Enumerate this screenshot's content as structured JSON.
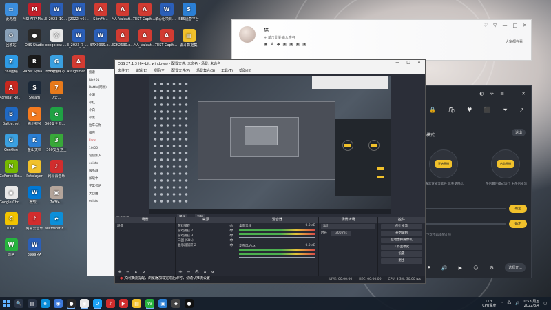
{
  "desktop": {
    "icons": [
      {
        "label": "此电脑",
        "color": "#3b8ede",
        "glyph": "▭"
      },
      {
        "label": "MSI APP Manager",
        "color": "#c41f2a",
        "glyph": "M"
      },
      {
        "label": "E_2023_10_3...",
        "color": "#2b5fb8",
        "glyph": "W"
      },
      {
        "label": "[2022_v6f...",
        "color": "#2b5fb8",
        "glyph": "W"
      },
      {
        "label": "SlimFit...",
        "color": "#d23b32",
        "glyph": "A"
      },
      {
        "label": "MA_Valuati...",
        "color": "#d23b32",
        "glyph": "A"
      },
      {
        "label": "TEST Capital Budgeting...",
        "color": "#d23b32",
        "glyph": "A"
      },
      {
        "label": "单心组项目计划",
        "color": "#2b5fb8",
        "glyph": "W"
      },
      {
        "label": "SES运营平台",
        "color": "#2b7fd4",
        "glyph": "S"
      },
      {
        "label": "回收站",
        "color": "#8aa1b8",
        "glyph": "♻"
      },
      {
        "label": "OBS Studio",
        "color": "#2a2a2a",
        "glyph": "●"
      },
      {
        "label": "bongo cat W 0.3.7",
        "color": "#e8e8e8",
        "glyph": "🐱"
      },
      {
        "label": "E_2023_7_2_H...",
        "color": "#2b5fb8",
        "glyph": "W"
      },
      {
        "label": "BRX3999.x...",
        "color": "#2b5fb8",
        "glyph": "W"
      },
      {
        "label": "ECK2630.x...",
        "color": "#d23b32",
        "glyph": "A"
      },
      {
        "label": "MA_Valuati...",
        "color": "#d23b32",
        "glyph": "A"
      },
      {
        "label": "TEST Capital Budgeting...",
        "color": "#d23b32",
        "glyph": "A"
      },
      {
        "label": "漏斗数据集",
        "color": "#f1c12b",
        "glyph": "▤"
      },
      {
        "label": "individual reflection",
        "color": "#2b5fb8",
        "glyph": "W"
      },
      {
        "label": "Assignment Cover Sheet",
        "color": "#d23b32",
        "glyph": "A"
      },
      {
        "label": "360压缩",
        "color": "#2e9be6",
        "glyph": "Z"
      },
      {
        "label": "Razer Synapse",
        "color": "#1a1a1a",
        "glyph": "R"
      },
      {
        "label": "米哈游 (2)",
        "color": "#3aa0e0",
        "glyph": "G"
      },
      {
        "label": "Acrobat Reader DC",
        "color": "#c8281f",
        "glyph": "A"
      },
      {
        "label": "Steam",
        "color": "#1b2838",
        "glyph": "S"
      },
      {
        "label": "7天...",
        "color": "#e87a1b",
        "glyph": "7"
      },
      {
        "label": "Battle.net",
        "color": "#2069c3",
        "glyph": "B"
      },
      {
        "label": "腾讯视频",
        "color": "#f47b20",
        "glyph": "▶"
      },
      {
        "label": "360安全浏览器",
        "color": "#1fa244",
        "glyph": "e"
      },
      {
        "label": "GeeGee",
        "color": "#3aa0e0",
        "glyph": "G"
      },
      {
        "label": "金山文档",
        "color": "#2b7fd4",
        "glyph": "K"
      },
      {
        "label": "360安全卫士",
        "color": "#38a839",
        "glyph": "3"
      },
      {
        "label": "GeForce Experience",
        "color": "#76b900",
        "glyph": "N"
      },
      {
        "label": "Potplayer",
        "color": "#f1c12b",
        "glyph": "▶"
      },
      {
        "label": "网易云音乐",
        "color": "#d12d2d",
        "glyph": "♪"
      },
      {
        "label": "Google Chrome",
        "color": "#e8e8e8",
        "glyph": "◉"
      },
      {
        "label": "微软...",
        "color": "#0078d4",
        "glyph": "W"
      },
      {
        "label": "7a3f4...",
        "color": "#b4a59b",
        "glyph": "▣"
      },
      {
        "label": "iCUE",
        "color": "#f2c400",
        "glyph": "C"
      },
      {
        "label": "网易云音乐",
        "color": "#d12d2d",
        "glyph": "♪"
      },
      {
        "label": "Microsoft Edge",
        "color": "#0c8fd9",
        "glyph": "e"
      },
      {
        "label": "微信",
        "color": "#27b43e",
        "glyph": "W"
      },
      {
        "label": "3999MA",
        "color": "#2b5fb8",
        "glyph": "W"
      }
    ]
  },
  "qq_window": {
    "name": "猫王",
    "signature": "+ 单击此处输入签名",
    "badges": "▣ ♛ ◆ ▣ ▣ ▣ ▣",
    "right_text": "大家都在看",
    "controls": [
      "♡",
      "▽",
      "—",
      "□",
      "✕"
    ]
  },
  "live_window": {
    "top_icons": [
      "◐",
      "✈",
      "≡",
      "—",
      "✕"
    ],
    "toolbar_icons": [
      "🔒",
      "🛍",
      "♥",
      "⬛",
      "⏷",
      "↗"
    ],
    "mode_label": "模式",
    "exit_label": "退出",
    "left_circle_label": "开始直播",
    "left_caption": "真三方推流软件 优先使用此",
    "right_circle_label": "启动开播",
    "right_caption": "伴侣最佳模式运行 由伴侣推流",
    "row_button_1": "确定",
    "row_button_2": "确定",
    "note": "下次不再提醒此项",
    "bottom_icons": [
      "⏺",
      "🔊",
      "▶",
      "☺",
      "⚙"
    ],
    "start_label": "选择开..."
  },
  "obs": {
    "title": "OBS 27.1.3 (64-bit, windows) - 配置文件: 未命名 - 场景: 未命名",
    "window_controls": [
      "—",
      "□",
      "✕"
    ],
    "menu": [
      "文件(F)",
      "编辑(E)",
      "视图(V)",
      "配置文件(P)",
      "场景集合(S)",
      "工具(T)",
      "帮助(H)"
    ],
    "docks": {
      "scenes": {
        "header": "场景",
        "items": [
          "场景"
        ]
      },
      "sources": {
        "header": "来源",
        "items": [
          "游戏捕获",
          "游戏捕获 2",
          "游戏捕获 3",
          "三国 (SDL)",
          "显示器捕获 2"
        ]
      },
      "mixer": {
        "header": "混音器",
        "tracks": [
          {
            "name": "桌面音频",
            "level": "0.0 dB"
          },
          {
            "name": "麦克风/Aux",
            "level": "0.0 dB"
          }
        ]
      },
      "transitions": {
        "header": "场景转场",
        "type": "淡出",
        "duration_label": "时长",
        "duration": "300 ms"
      },
      "controls": {
        "header": "控件",
        "buttons": [
          "停止推流",
          "开始录制",
          "启动虚拟摄像机",
          "工作室模式",
          "设置",
          "退出"
        ]
      }
    },
    "panel_labels": {
      "scene_filter": "无选择源",
      "props": "属性",
      "filters": "滤镜"
    },
    "status": {
      "live": "LIVE: 00:00:00",
      "rec": "REC: 00:00:00",
      "cpu": "CPU: 3.3%, 30.00 fps"
    }
  },
  "chat_sidebar": {
    "items": [
      "搜索",
      "Rb#01",
      "Battle(网易)",
      "小明",
      "小红",
      "小白",
      "小黑",
      "拉车与你",
      "排序",
      "Fans",
      "10/05",
      "包包加入",
      "exists",
      "服务器",
      "加载中",
      "学常考语",
      "大自由",
      "exists"
    ]
  },
  "notice": "关闭推流提醒，浏览器加载完成后即可，请确认推流设置",
  "taskbar": {
    "apps": [
      {
        "glyph": "🔍",
        "color": "#2a3446"
      },
      {
        "glyph": "▤",
        "color": "#2a3446"
      },
      {
        "glyph": "e",
        "color": "#0c8fd9"
      },
      {
        "glyph": "◉",
        "color": "#3c78d8"
      },
      {
        "glyph": "●",
        "color": "#2a2a2a"
      },
      {
        "glyph": "◉",
        "color": "#e8e8e8"
      },
      {
        "glyph": "Q",
        "color": "#1aa1f5"
      },
      {
        "glyph": "♪",
        "color": "#d12d2d"
      },
      {
        "glyph": "▶",
        "color": "#d12d2d"
      },
      {
        "glyph": "▤",
        "color": "#f1c12b"
      },
      {
        "glyph": "W",
        "color": "#27b43e"
      },
      {
        "glyph": "▣",
        "color": "#2b7fd4"
      },
      {
        "glyph": "◆",
        "color": "#444"
      },
      {
        "glyph": "●",
        "color": "#111"
      }
    ],
    "temperature": "11℃",
    "weather": "CPU温度",
    "time": "0:53 周五",
    "date": "2022/3/4"
  }
}
